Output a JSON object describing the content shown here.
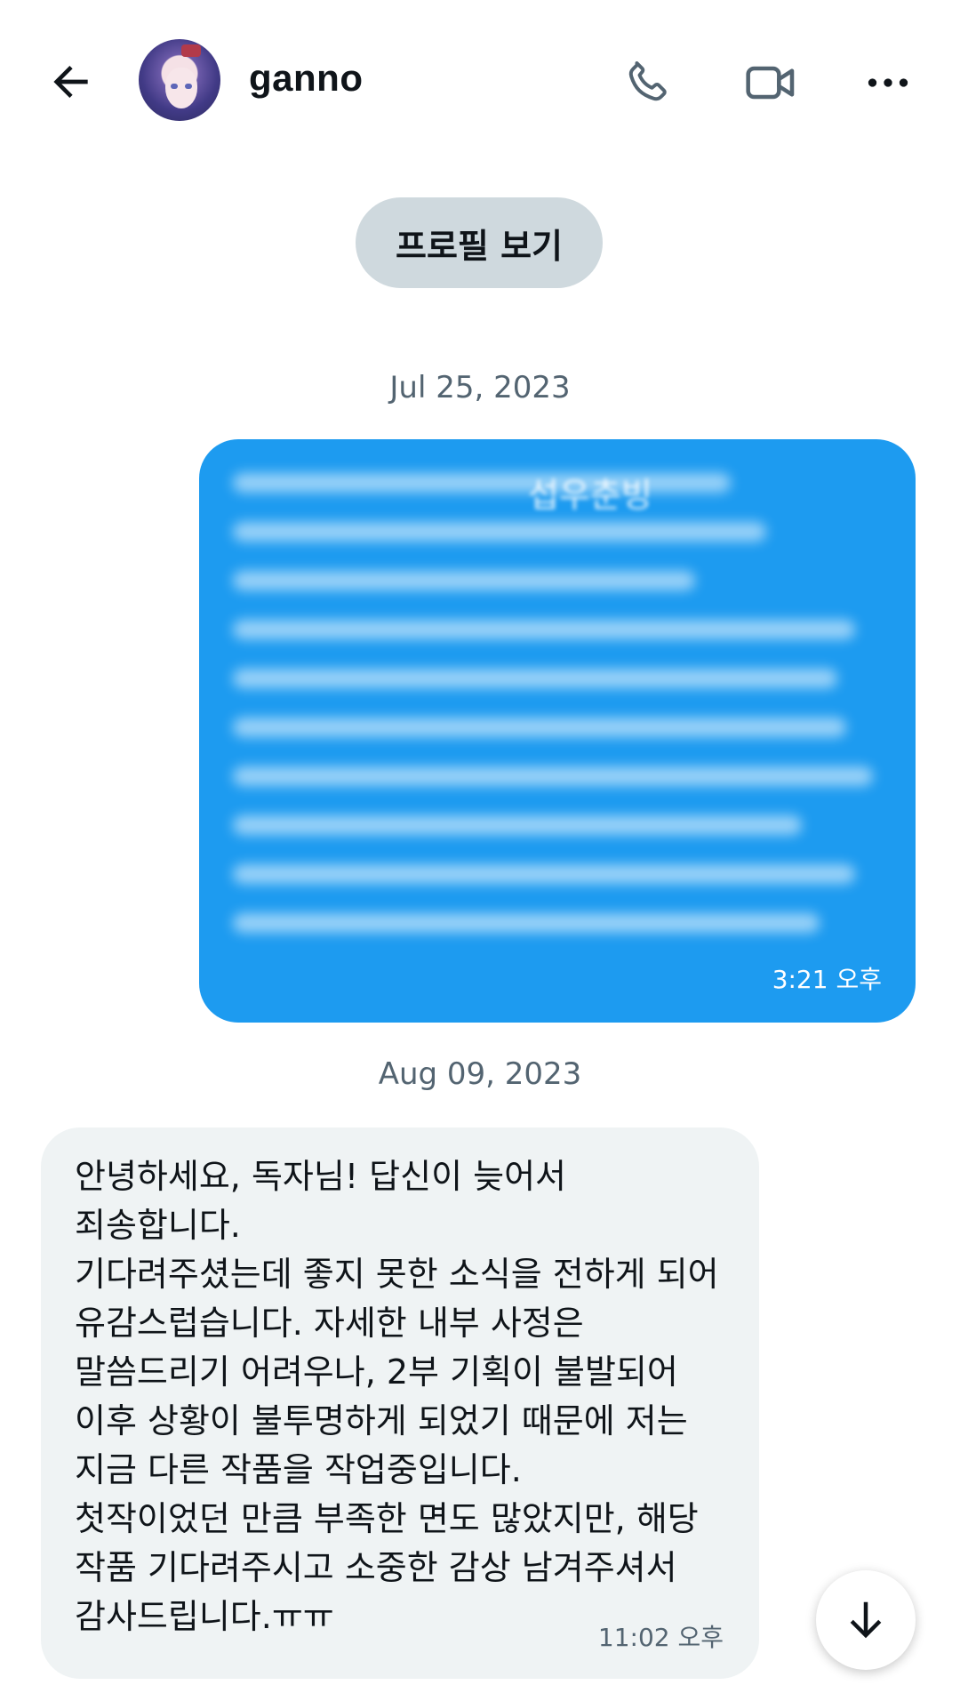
{
  "header": {
    "username": "ganno"
  },
  "icons": {
    "back": "back-arrow-icon",
    "phone": "phone-icon",
    "video": "video-icon",
    "more": "more-icon",
    "scroll": "arrow-down-icon"
  },
  "profile_button": {
    "label": "프로필 보기"
  },
  "conversation": {
    "dates": [
      "Jul 25, 2023",
      "Aug 09, 2023"
    ],
    "messages": [
      {
        "direction": "sent",
        "visible_fragment": "섭우춘빙",
        "blurred": true,
        "time": "3:21 오후"
      },
      {
        "direction": "received",
        "text": "안녕하세요, 독자님! 답신이 늦어서\n죄송합니다.\n기다려주셨는데 좋지 못한 소식을 전하게 되어\n유감스럽습니다. 자세한 내부 사정은\n말씀드리기 어려우나, 2부 기획이 불발되어\n이후 상황이 불투명하게 되었기 때문에 저는\n지금 다른 작품을 작업중입니다.\n첫작이었던 만큼 부족한 면도 많았지만, 해당\n작품 기다려주시고 소중한 감상 남겨주셔서\n감사드립니다.ㅠㅠ",
        "time": "11:02 오후"
      }
    ]
  },
  "colors": {
    "sent_bubble": "#1d9bf0",
    "received_bubble": "#eff3f4",
    "profile_button_bg": "#cfd9de",
    "secondary_text": "#536471"
  }
}
